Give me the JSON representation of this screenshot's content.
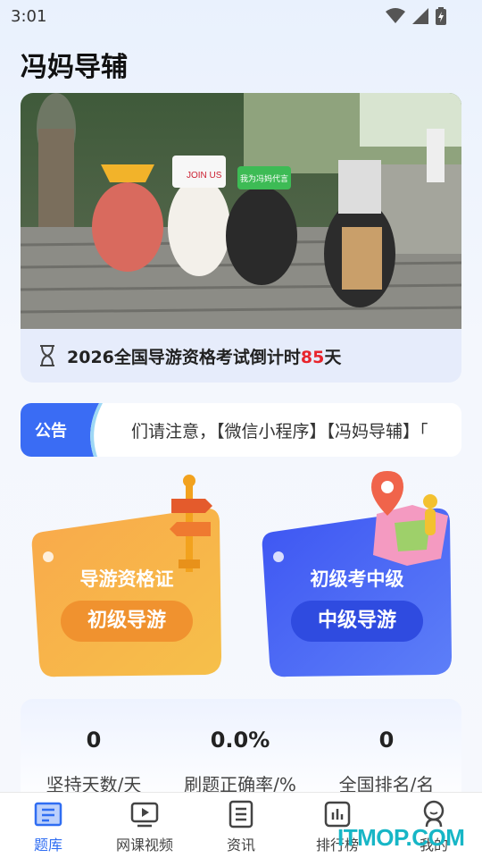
{
  "status_bar": {
    "time": "3:01"
  },
  "app": {
    "title": "冯妈导辅"
  },
  "banner": {
    "sign_text_left": "JOIN US",
    "sign_text_mid": "我为冯妈代言",
    "countdown": {
      "prefix": "2026全国导游资格考试倒计时",
      "days": "85",
      "suffix": "天"
    },
    "dots": 2
  },
  "notice": {
    "label": "公告",
    "text": "们请注意，【微信小程序】【冯妈导辅】「"
  },
  "cards": [
    {
      "subtitle": "导游资格证",
      "button": "初级导游",
      "color": "#f6a53c"
    },
    {
      "subtitle": "初级考中级",
      "button": "中级导游",
      "color": "#3b5cf5"
    }
  ],
  "stats": [
    {
      "value": "0",
      "label": "坚持天数/天"
    },
    {
      "value": "0.0%",
      "label": "刷题正确率/%"
    },
    {
      "value": "0",
      "label": "全国排名/名"
    }
  ],
  "tabs": [
    {
      "label": "题库",
      "icon": "question-bank-icon",
      "active": true
    },
    {
      "label": "网课视频",
      "icon": "video-icon",
      "active": false
    },
    {
      "label": "资讯",
      "icon": "news-icon",
      "active": false
    },
    {
      "label": "排行榜",
      "icon": "ranking-icon",
      "active": false
    },
    {
      "label": "我的",
      "icon": "profile-icon",
      "active": false
    }
  ],
  "watermark": "ITMOP.COM",
  "colors": {
    "accent": "#2f6df2",
    "countdown_red": "#e8242c",
    "notice_blue": "#3a6cf4"
  }
}
